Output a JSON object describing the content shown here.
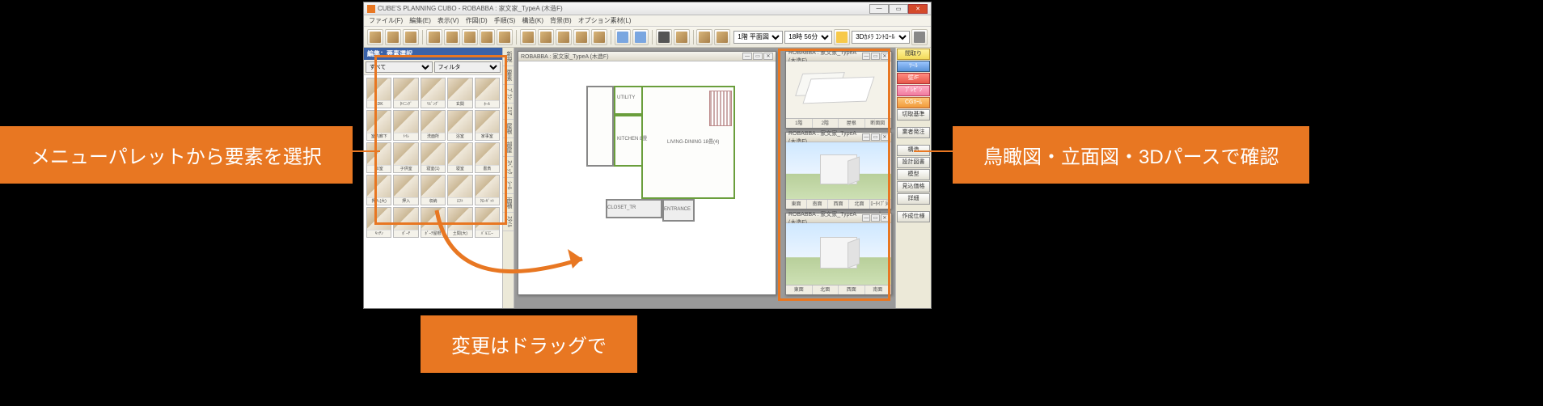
{
  "callouts": {
    "left": "メニューパレットから要素を選択",
    "bottom": "変更はドラッグで",
    "right": "鳥瞰図・立面図・3Dパースで確認"
  },
  "titlebar": {
    "title": "CUBE'S PLANNING CUBO - ROBABBA : 家文家_TypeA (木造F)"
  },
  "menus": [
    "ファイル(F)",
    "編集(E)",
    "表示(V)",
    "作図(D)",
    "手順(S)",
    "構造(K)",
    "背景(B)",
    "オプション素材(L)"
  ],
  "toolbar_controls": {
    "mode_label": "1階 平面図",
    "time_label": "18時 56分",
    "viewmode": "3Dｶﾒﾗ ｺﾝﾄﾛｰﾙ"
  },
  "palette": {
    "header": "編集：要素選択",
    "filters": [
      "すべて",
      "フィルタ"
    ],
    "items": [
      {
        "label": "LDK"
      },
      {
        "label": "ﾀｲﾆﾝｸﾞ"
      },
      {
        "label": "ﾘﾋﾞﾝｸﾞ"
      },
      {
        "label": "玄関"
      },
      {
        "label": "ﾎｰﾙ"
      },
      {
        "label": "室内廊下"
      },
      {
        "label": "ﾄｲﾚ"
      },
      {
        "label": "洗面所"
      },
      {
        "label": "浴室"
      },
      {
        "label": "家事室"
      },
      {
        "label": "和室"
      },
      {
        "label": "子供室"
      },
      {
        "label": "寝室(1)"
      },
      {
        "label": "寝室"
      },
      {
        "label": "書斎"
      },
      {
        "label": "押入(大)"
      },
      {
        "label": "押入"
      },
      {
        "label": "収納"
      },
      {
        "label": "ﾛﾌﾄ"
      },
      {
        "label": "ｸﾛｰｾﾞｯﾄ"
      },
      {
        "label": "ｷｯﾁﾝ"
      },
      {
        "label": "ﾎﾟｰﾁ"
      },
      {
        "label": "ﾎﾟｰﾁ屋根"
      },
      {
        "label": "土間(大)"
      },
      {
        "label": "ﾊﾞﾙｺﾆｰ"
      }
    ]
  },
  "vtabs": [
    "新規",
    "要素",
    "ﾌﾟﾗﾝ",
    "ｴﾘｱ",
    "屋根",
    "部屋",
    "ｽﾍﾟｯｸ",
    "ｼｰﾙ",
    "面積",
    "ｽﾀｲﾙ"
  ],
  "plan_window": {
    "title": "ROBABBA : 家文家_TypeA (木造F)",
    "rooms": {
      "utility": "UTILITY",
      "kitchen": "KITCHEN 8畳",
      "living": "LIVING-DINING 18畳(4)",
      "closet": "CLOSET_TR",
      "entrance": "ENTRANCE"
    }
  },
  "view_tabs_bird": [
    "1階",
    "2階",
    "屋根",
    "断面図"
  ],
  "view_tabs_elev": [
    "東面",
    "南面",
    "西面",
    "北面",
    "ﾛｰﾀｲﾌﾟ見ﾙ"
  ],
  "view_tabs_pers": [
    "東面",
    "北面",
    "西面",
    "南面"
  ],
  "view_window_header": {
    "bird": "ROBABBA : 家文家_TypeA (木造F)",
    "elev": "ROBABBA : 家文家_TypeA (木造F)",
    "pers": "ROBABBA : 家文家_TypeA (木造F)"
  },
  "right_buttons": [
    {
      "label": "間取り",
      "cls": "yellow"
    },
    {
      "label": "ﾂｰﾙ",
      "cls": "blue"
    },
    {
      "label": "壁/F",
      "cls": "red"
    },
    {
      "label": "ﾌﾟﾚｾﾞﾝ",
      "cls": "pink"
    },
    {
      "label": "CGﾎｰﾑ",
      "cls": "orange"
    },
    {
      "label": "切取基準",
      "cls": ""
    },
    {
      "label": "",
      "cls": "rsep"
    },
    {
      "label": "業者発注",
      "cls": ""
    },
    {
      "label": "",
      "cls": "rsep"
    },
    {
      "label": "構造",
      "cls": ""
    },
    {
      "label": "設計図書",
      "cls": ""
    },
    {
      "label": "模型",
      "cls": ""
    },
    {
      "label": "見込価格",
      "cls": ""
    },
    {
      "label": "詳細",
      "cls": ""
    },
    {
      "label": "",
      "cls": "rsep"
    },
    {
      "label": "作成仕様",
      "cls": ""
    }
  ]
}
